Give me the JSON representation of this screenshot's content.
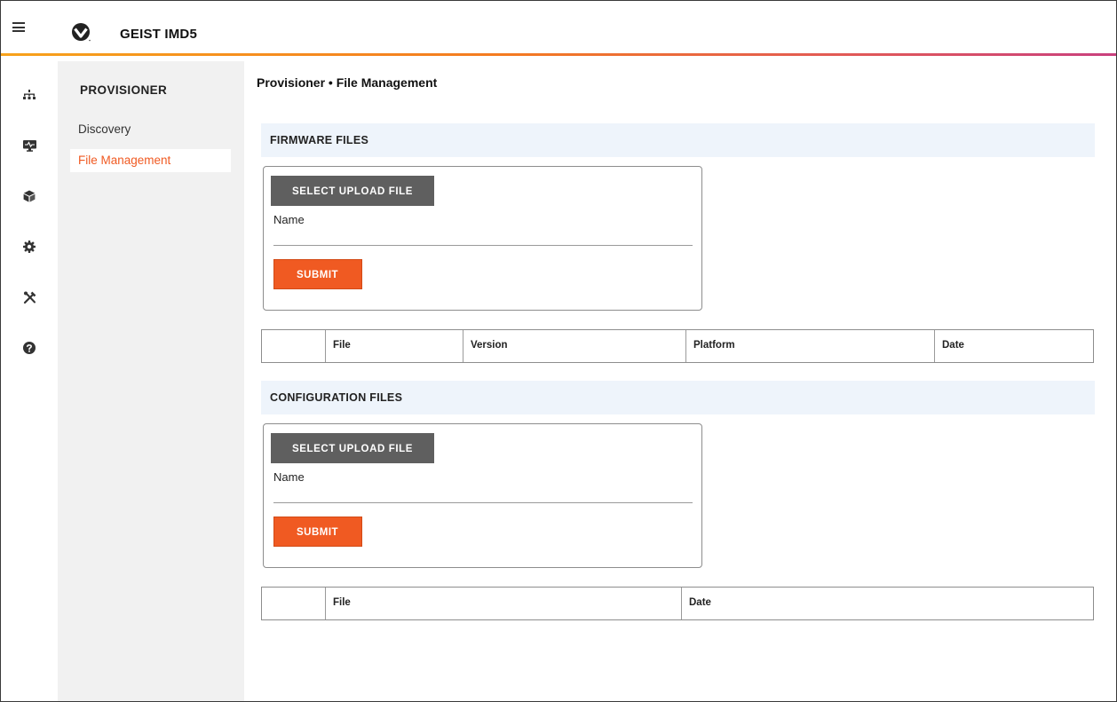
{
  "app": {
    "title": "GEIST IMD5"
  },
  "rail": {
    "icons": [
      "network-icon",
      "monitor-icon",
      "cube-icon",
      "gear-icon",
      "tools-icon",
      "help-icon"
    ]
  },
  "sidebar": {
    "title": "PROVISIONER",
    "items": [
      {
        "label": "Discovery",
        "active": false
      },
      {
        "label": "File Management",
        "active": true
      }
    ]
  },
  "main": {
    "title": "Provisioner • File Management",
    "firmware": {
      "header": "FIRMWARE FILES",
      "select_label": "SELECT UPLOAD FILE",
      "name_label": "Name",
      "name_value": "",
      "submit_label": "SUBMIT",
      "columns": [
        "File",
        "Version",
        "Platform",
        "Date"
      ]
    },
    "configuration": {
      "header": "CONFIGURATION FILES",
      "select_label": "SELECT UPLOAD FILE",
      "name_label": "Name",
      "name_value": "",
      "submit_label": "SUBMIT",
      "columns": [
        "File",
        "Date"
      ]
    }
  },
  "colors": {
    "accent": "#f05a22",
    "section_bg": "#eef4fb",
    "sidebar_bg": "#f1f1f1",
    "select_button_bg": "#5f5f5f"
  }
}
